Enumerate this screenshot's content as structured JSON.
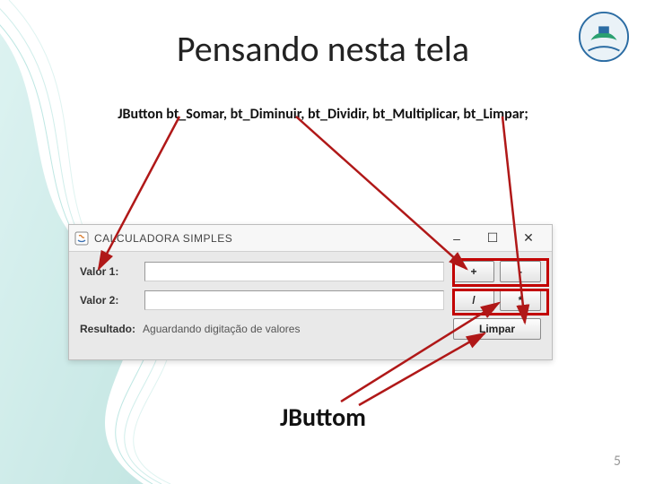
{
  "slide": {
    "title": "Pensando nesta tela",
    "code_line": "JButton bt_Somar, bt_Diminuir, bt_Dividir, bt_Multiplicar, bt_Limpar;",
    "sub_label": "JButtom",
    "page_number": "5"
  },
  "window": {
    "title": "CALCULADORA SIMPLES",
    "controls": {
      "min": "–",
      "max": "☐",
      "close": "✕"
    },
    "labels": {
      "valor1": "Valor 1:",
      "valor2": "Valor 2:",
      "resultado": "Resultado:"
    },
    "result_text": "Aguardando digitação de valores",
    "buttons": {
      "plus": "+",
      "minus": "-",
      "div": "/",
      "mul": "*",
      "clear": "Limpar"
    }
  }
}
